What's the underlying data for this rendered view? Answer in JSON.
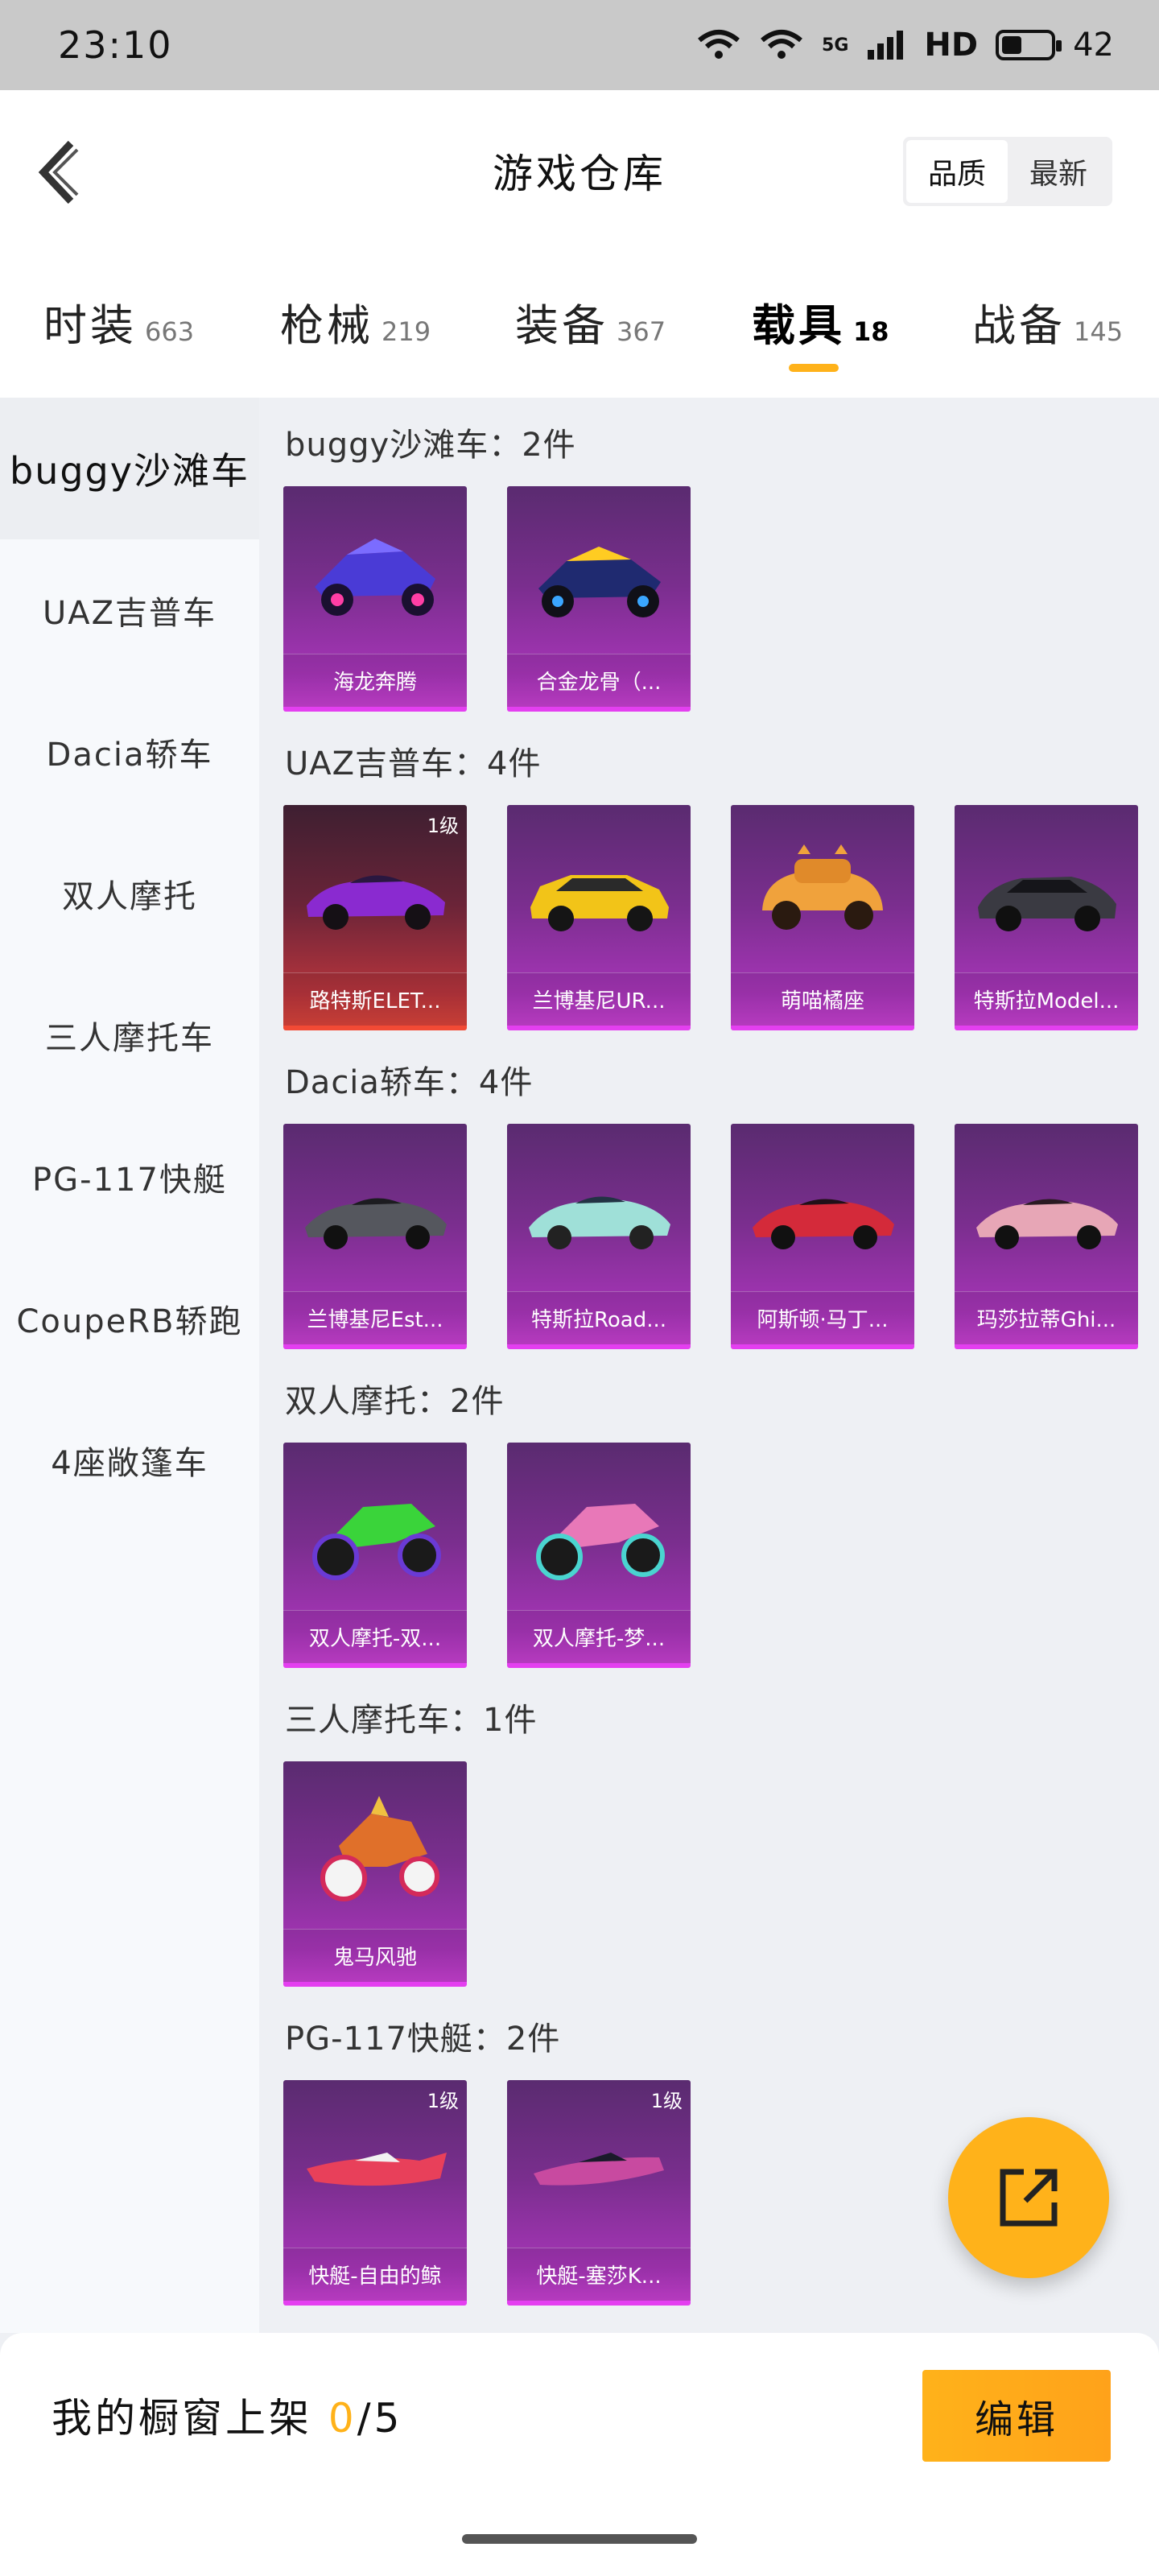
{
  "status_bar": {
    "time": "23:10",
    "network": "5G",
    "hd": "HD",
    "battery": "42",
    "battery_fraction": 0.42
  },
  "header": {
    "title": "游戏仓库",
    "sort_options": [
      "品质",
      "最新"
    ],
    "sort_selected": "品质"
  },
  "tabs": [
    {
      "label": "时装",
      "count": "663"
    },
    {
      "label": "枪械",
      "count": "219"
    },
    {
      "label": "装备",
      "count": "367"
    },
    {
      "label": "载具",
      "count": "18",
      "active": true
    },
    {
      "label": "战备",
      "count": "145"
    }
  ],
  "sidebar": {
    "items": [
      "buggy沙滩车",
      "UAZ吉普车",
      "Dacia轿车",
      "双人摩托",
      "三人摩托车",
      "PG-117快艇",
      "CoupeRB轿跑",
      "4座敞篷车"
    ],
    "active": "buggy沙滩车"
  },
  "sections": [
    {
      "title": "buggy沙滩车：2件",
      "items": [
        {
          "name": "海龙奔腾",
          "icon": "buggy-icon"
        },
        {
          "name": "合金龙骨（...",
          "icon": "buggy-icon"
        }
      ]
    },
    {
      "title": "UAZ吉普车：4件",
      "items": [
        {
          "name": "路特斯ELET...",
          "icon": "car-icon",
          "badge": "1级",
          "rarity": "red"
        },
        {
          "name": "兰博基尼UR...",
          "icon": "suv-icon"
        },
        {
          "name": "萌喵橘座",
          "icon": "car-icon"
        },
        {
          "name": "特斯拉Model...",
          "icon": "suv-icon"
        }
      ]
    },
    {
      "title": "Dacia轿车：4件",
      "items": [
        {
          "name": "兰博基尼Est...",
          "icon": "car-icon"
        },
        {
          "name": "特斯拉Road...",
          "icon": "car-icon"
        },
        {
          "name": "阿斯顿·马丁...",
          "icon": "car-icon"
        },
        {
          "name": "玛莎拉蒂Ghi...",
          "icon": "car-icon"
        }
      ]
    },
    {
      "title": "双人摩托：2件",
      "items": [
        {
          "name": "双人摩托-双...",
          "icon": "motorbike-icon"
        },
        {
          "name": "双人摩托-梦...",
          "icon": "motorbike-icon"
        }
      ]
    },
    {
      "title": "三人摩托车：1件",
      "items": [
        {
          "name": "鬼马风驰",
          "icon": "motorbike-icon"
        }
      ]
    },
    {
      "title": "PG-117快艇：2件",
      "items": [
        {
          "name": "快艇-自由的鲸",
          "icon": "boat-icon",
          "badge": "1级"
        },
        {
          "name": "快艇-塞莎K...",
          "icon": "boat-icon",
          "badge": "1级"
        }
      ]
    }
  ],
  "bottom_bar": {
    "shelf_label": "我的橱窗上架",
    "shelf_current": "0",
    "shelf_total": "/5",
    "edit_label": "编辑"
  },
  "colors": {
    "accent": "#ffb21a",
    "card_purple": "#a535b6",
    "card_red": "#d8433a"
  }
}
